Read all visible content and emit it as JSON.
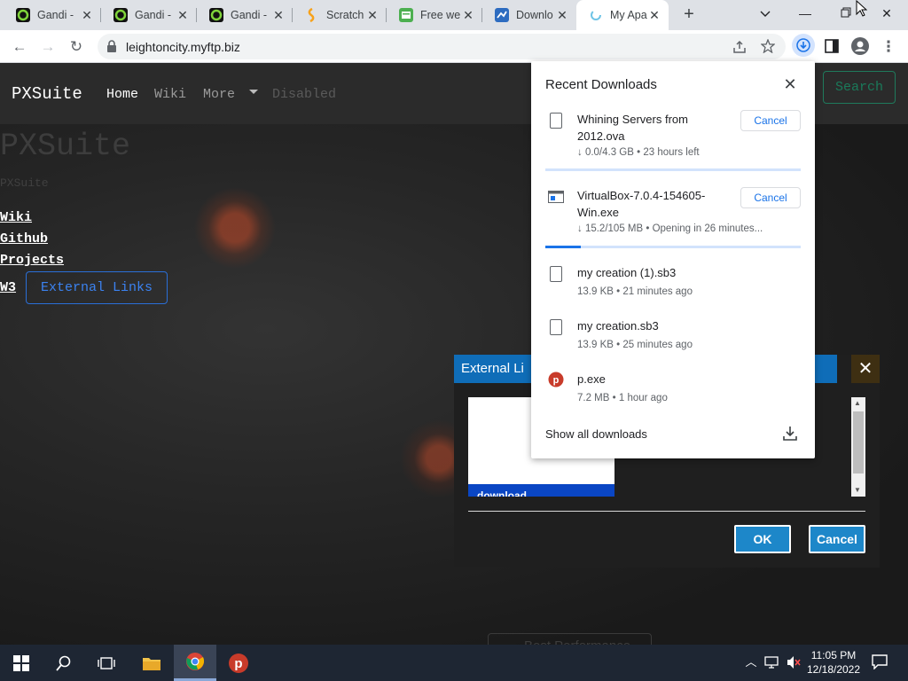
{
  "browser": {
    "tabs": [
      {
        "title": "Gandi -",
        "icon": "gandi-icon"
      },
      {
        "title": "Gandi -",
        "icon": "gandi-icon"
      },
      {
        "title": "Gandi -",
        "icon": "gandi-icon"
      },
      {
        "title": "Scratch",
        "icon": "scratch-icon"
      },
      {
        "title": "Free we",
        "icon": "webhost-icon"
      },
      {
        "title": "Downlo",
        "icon": "download-site-icon"
      },
      {
        "title": "My Apa",
        "icon": "loading-icon",
        "active": true
      }
    ],
    "url": "leightoncity.myftp.biz"
  },
  "site": {
    "brand": "PXSuite",
    "nav": {
      "home": "Home",
      "wiki": "Wiki",
      "more": "More",
      "disabled": "Disabled",
      "search": "Search"
    },
    "title": "PXSuite",
    "subtitle": "PXSuite",
    "links": [
      "Wiki",
      "Github",
      "Projects",
      "W3"
    ],
    "external_button": "External Links",
    "best_performance": "Best Performance"
  },
  "dialog": {
    "title": "External Li",
    "list_selected": "download",
    "ok": "OK",
    "cancel": "Cancel"
  },
  "downloads": {
    "title": "Recent Downloads",
    "items": [
      {
        "name_line1": "Whining Servers from",
        "name_line2": "2012.ova",
        "status": "↓ 0.0/4.3 GB • 23 hours left",
        "action": "Cancel",
        "progress": 0.0
      },
      {
        "name_line1": "VirtualBox-7.0.4-154605-",
        "name_line2": "Win.exe",
        "status": "↓ 15.2/105 MB • Opening in 26 minutes...",
        "action": "Cancel",
        "progress": 0.14
      },
      {
        "name_line1": "my creation (1).sb3",
        "status": "13.9 KB • 21 minutes ago"
      },
      {
        "name_line1": "my creation.sb3",
        "status": "13.9 KB • 25 minutes ago"
      },
      {
        "name_line1": "p.exe",
        "status": "7.2 MB • 1 hour ago"
      }
    ],
    "show_all": "Show all downloads"
  },
  "taskbar": {
    "time": "11:05 PM",
    "date": "12/18/2022"
  },
  "colors": {
    "chrome_blue": "#1a73e8",
    "dialog_header": "#0f6db8",
    "dialog_button": "#1d87c9",
    "search_green": "#1a7a5a"
  }
}
